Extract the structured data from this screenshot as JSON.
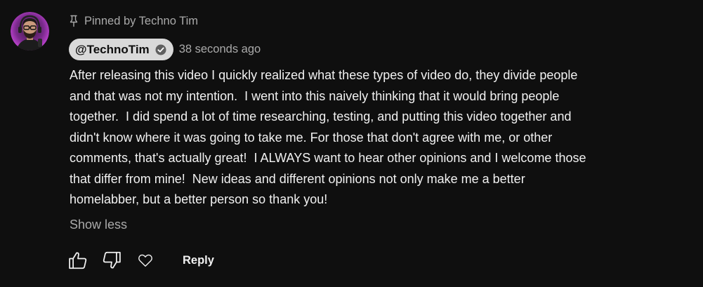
{
  "comment": {
    "pinned_label": "Pinned by Techno Tim",
    "author": "@TechnoTim",
    "author_verified": true,
    "timestamp": "38 seconds ago",
    "text": "After releasing this video I quickly realized what these types of video do, they divide people\nand that was not my intention.  I went into this naively thinking that it would bring people\ntogether.  I did spend a lot of time researching, testing, and putting this video together and\ndidn't know where it was going to take me. For those that don't agree with me, or other\ncomments, that's actually great!  I ALWAYS want to hear other opinions and I welcome those\nthat differ from mine!  New ideas and different opinions not only make me a better\nhomelabber, but a better person so thank you!",
    "show_less_label": "Show less"
  },
  "actions": {
    "like_icon": "thumbs-up-icon",
    "dislike_icon": "thumbs-down-icon",
    "heart_icon": "heart-icon",
    "reply_label": "Reply"
  },
  "colors": {
    "background": "#0f0f0f",
    "text": "#f1f1f1",
    "secondary_text": "#aaaaaa",
    "author_chip_bg": "#d9d9d9",
    "avatar_glow": "#c23bd8"
  }
}
